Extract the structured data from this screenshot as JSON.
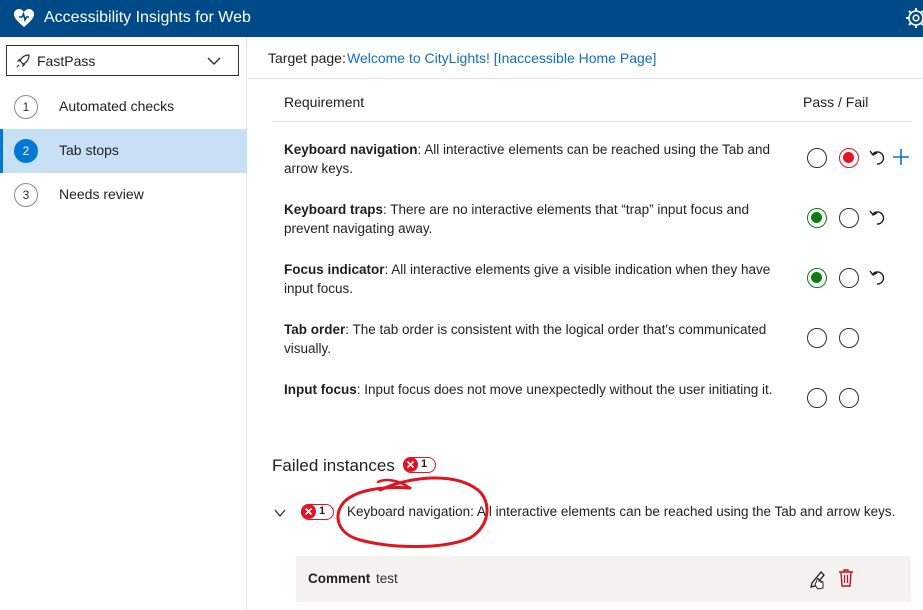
{
  "app": {
    "title": "Accessibility Insights for Web",
    "icons": {
      "logo": "heart-shield-icon",
      "settings": "gear-icon"
    }
  },
  "sidebar": {
    "mode_select": {
      "value": "FastPass",
      "icon": "rocket-icon"
    },
    "items": [
      {
        "number": "1",
        "label": "Automated checks",
        "selected": false
      },
      {
        "number": "2",
        "label": "Tab stops",
        "selected": true
      },
      {
        "number": "3",
        "label": "Needs review",
        "selected": false
      }
    ]
  },
  "target": {
    "prefix": "Target page:",
    "link": "Welcome to CityLights! [Inaccessible Home Page]"
  },
  "table": {
    "headers": {
      "requirement": "Requirement",
      "pass_fail": "Pass / Fail"
    },
    "rows": [
      {
        "name": "Keyboard navigation",
        "description": ": All interactive elements can be reached using the Tab and arrow keys.",
        "status": "fail"
      },
      {
        "name": "Keyboard traps",
        "description": ": There are no interactive elements that “trap” input focus and prevent navigating away.",
        "status": "pass"
      },
      {
        "name": "Focus indicator",
        "description": ": All interactive elements give a visible indication when they have input focus.",
        "status": "pass"
      },
      {
        "name": "Tab order",
        "description": ": The tab order is consistent with the logical order that's communicated visually.",
        "status": "unknown"
      },
      {
        "name": "Input focus",
        "description": ": Input focus does not move unexpectedly without the user initiating it.",
        "status": "unknown"
      }
    ]
  },
  "failed": {
    "title": "Failed instances",
    "count": "1",
    "instance": {
      "count": "1",
      "text": "Keyboard navigation: All interactive elements can be reached using the Tab and arrow keys."
    },
    "comment": {
      "label": "Comment",
      "value": "test"
    }
  },
  "colors": {
    "titlebar": "#004b87",
    "accent": "#0078d4",
    "selected_nav": "#c7e0f4",
    "pass": "#107c10",
    "fail": "#e81123",
    "link": "#106ebe",
    "annotation": "#e0131f"
  }
}
